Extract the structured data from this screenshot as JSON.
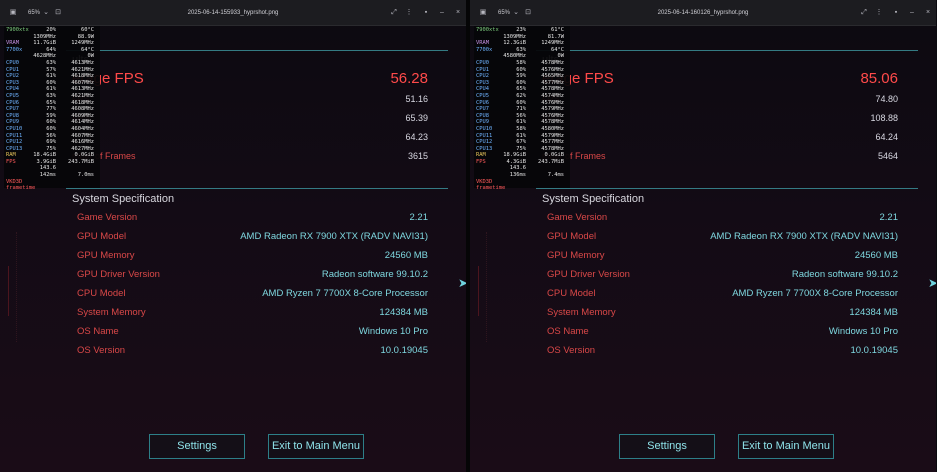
{
  "panes": [
    {
      "titlebar": {
        "zoom": "65%",
        "filename": "2025-06-14-155933_hyprshot.png"
      },
      "osd": {
        "rows": [
          [
            "7900xtx",
            "20%",
            "60°C"
          ],
          [
            "",
            "1309MHz",
            "88.9W"
          ],
          [
            "VRAM",
            "11.7GiB",
            "1249MHz"
          ],
          [
            "7700x",
            "64%",
            "64°C"
          ],
          [
            "",
            "4628MHz",
            "0W"
          ],
          [
            "CPU0",
            "63%",
            "4613MHz"
          ],
          [
            "CPU1",
            "57%",
            "4621MHz"
          ],
          [
            "CPU2",
            "61%",
            "4618MHz"
          ],
          [
            "CPU3",
            "60%",
            "4607MHz"
          ],
          [
            "CPU4",
            "61%",
            "4613MHz"
          ],
          [
            "CPU5",
            "63%",
            "4621MHz"
          ],
          [
            "CPU6",
            "65%",
            "4618MHz"
          ],
          [
            "CPU7",
            "77%",
            "4608MHz"
          ],
          [
            "CPU8",
            "59%",
            "4609MHz"
          ],
          [
            "CPU9",
            "60%",
            "4614MHz"
          ],
          [
            "CPU10",
            "60%",
            "4604MHz"
          ],
          [
            "CPU11",
            "56%",
            "4607MHz"
          ],
          [
            "CPU12",
            "69%",
            "4616MHz"
          ],
          [
            "CPU13",
            "75%",
            "4627MHz"
          ],
          [
            "RAM",
            "18.4GiB",
            "0.0GiB"
          ],
          [
            "FPS",
            "3.9GiB",
            "243.7MiB"
          ],
          [
            "",
            "143.6",
            ""
          ],
          [
            "",
            "142ms",
            "7.0ms"
          ],
          [
            "VKD3D",
            "",
            ""
          ],
          [
            "frametime",
            "",
            ""
          ]
        ]
      },
      "results": {
        "title": "ults",
        "avg_label": "erage FPS",
        "avg_value": "56.28",
        "rows": [
          {
            "label": "FPS",
            "value": "51.16"
          },
          {
            "label": "FPS",
            "value": "65.39"
          },
          {
            "label": "",
            "value": "64.23"
          },
          {
            "label": "mber of Frames",
            "value": "3615"
          }
        ]
      },
      "system": {
        "title": "System Specification",
        "rows": [
          {
            "label": "Game Version",
            "value": "2.21"
          },
          {
            "label": "GPU Model",
            "value": "AMD Radeon RX 7900 XTX (RADV NAVI31)"
          },
          {
            "label": "GPU Memory",
            "value": "24560 MB"
          },
          {
            "label": "GPU Driver Version",
            "value": "Radeon software 99.10.2"
          },
          {
            "label": "CPU Model",
            "value": "AMD Ryzen 7 7700X 8-Core Processor"
          },
          {
            "label": "System Memory",
            "value": "124384 MB"
          },
          {
            "label": "OS Name",
            "value": "Windows 10 Pro"
          },
          {
            "label": "OS Version",
            "value": "10.0.19045"
          }
        ]
      },
      "buttons": {
        "settings": "Settings",
        "exit": "Exit to Main Menu"
      }
    },
    {
      "titlebar": {
        "zoom": "65%",
        "filename": "2025-06-14-160126_hyprshot.png"
      },
      "osd": {
        "rows": [
          [
            "7900xtx",
            "23%",
            "61°C"
          ],
          [
            "",
            "1309MHz",
            "81.7W"
          ],
          [
            "VRAM",
            "12.3GiB",
            "1249MHz"
          ],
          [
            "7700x",
            "63%",
            "64°C"
          ],
          [
            "",
            "4580MHz",
            "0W"
          ],
          [
            "CPU0",
            "58%",
            "4578MHz"
          ],
          [
            "CPU1",
            "60%",
            "4576MHz"
          ],
          [
            "CPU2",
            "59%",
            "4565MHz"
          ],
          [
            "CPU3",
            "60%",
            "4577MHz"
          ],
          [
            "CPU4",
            "65%",
            "4578MHz"
          ],
          [
            "CPU5",
            "62%",
            "4574MHz"
          ],
          [
            "CPU6",
            "60%",
            "4576MHz"
          ],
          [
            "CPU7",
            "71%",
            "4579MHz"
          ],
          [
            "CPU8",
            "56%",
            "4576MHz"
          ],
          [
            "CPU9",
            "61%",
            "4578MHz"
          ],
          [
            "CPU10",
            "58%",
            "4580MHz"
          ],
          [
            "CPU11",
            "61%",
            "4579MHz"
          ],
          [
            "CPU12",
            "67%",
            "4577MHz"
          ],
          [
            "CPU13",
            "75%",
            "4578MHz"
          ],
          [
            "RAM",
            "18.9GiB",
            "0.0GiB"
          ],
          [
            "FPS",
            "4.3GiB",
            "243.7MiB"
          ],
          [
            "",
            "143.6",
            ""
          ],
          [
            "",
            "136ms",
            "7.4ms"
          ],
          [
            "VKD3D",
            "",
            ""
          ],
          [
            "frametime",
            "",
            ""
          ]
        ]
      },
      "results": {
        "title": "ults",
        "avg_label": "erage FPS",
        "avg_value": "85.06",
        "rows": [
          {
            "label": "FPS",
            "value": "74.80"
          },
          {
            "label": "FPS",
            "value": "108.88"
          },
          {
            "label": "",
            "value": "64.24"
          },
          {
            "label": "mber of Frames",
            "value": "5464"
          }
        ]
      },
      "system": {
        "title": "System Specification",
        "rows": [
          {
            "label": "Game Version",
            "value": "2.21"
          },
          {
            "label": "GPU Model",
            "value": "AMD Radeon RX 7900 XTX (RADV NAVI31)"
          },
          {
            "label": "GPU Memory",
            "value": "24560 MB"
          },
          {
            "label": "GPU Driver Version",
            "value": "Radeon software 99.10.2"
          },
          {
            "label": "CPU Model",
            "value": "AMD Ryzen 7 7700X 8-Core Processor"
          },
          {
            "label": "System Memory",
            "value": "124384 MB"
          },
          {
            "label": "OS Name",
            "value": "Windows 10 Pro"
          },
          {
            "label": "OS Version",
            "value": "10.0.19045"
          }
        ]
      },
      "buttons": {
        "settings": "Settings",
        "exit": "Exit to Main Menu"
      }
    }
  ],
  "titlebar_icons": [
    "image-icon",
    "zoom-dropdown-icon",
    "fit-icon",
    "expand-icon",
    "menu-dots-icon",
    "pin-icon",
    "minimize-icon",
    "close-icon"
  ],
  "colors": {
    "accent_red": "#ff4a4a",
    "label_red": "#d94848",
    "value_cyan": "#7fd8e0",
    "line_teal": "#3b8f98"
  }
}
